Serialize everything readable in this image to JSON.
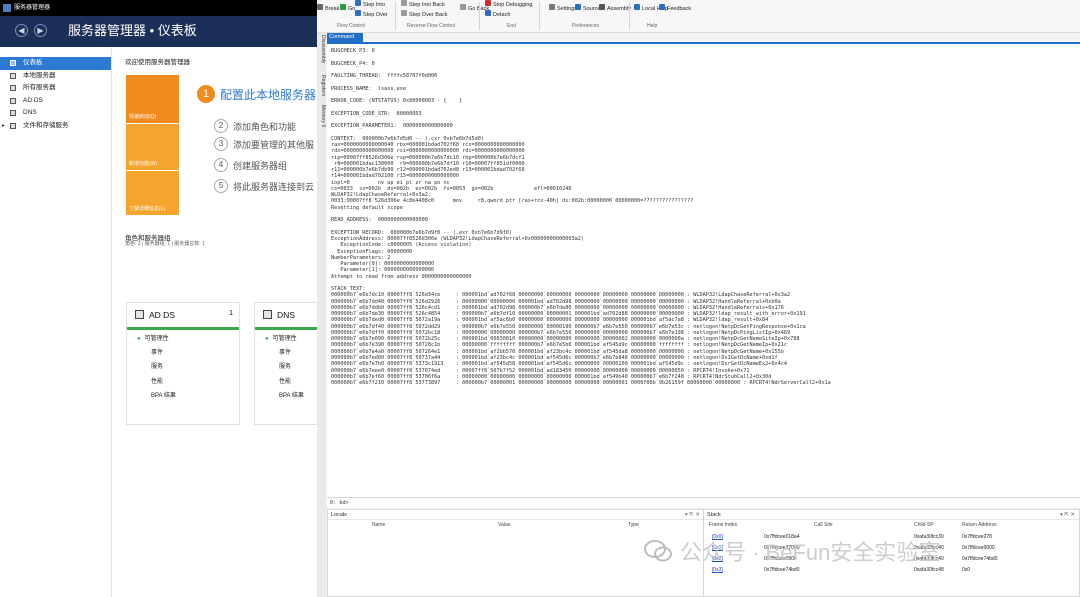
{
  "server_manager": {
    "window_title": "服务器管理器",
    "header_title": "服务器管理器 • 仪表板",
    "nav_items": [
      {
        "label": "仪表板",
        "selected": true,
        "icon": "dashboard-icon",
        "expander": ""
      },
      {
        "label": "本地服务器",
        "selected": false,
        "icon": "server-icon",
        "expander": ""
      },
      {
        "label": "所有服务器",
        "selected": false,
        "icon": "servers-icon",
        "expander": ""
      },
      {
        "label": "AD DS",
        "selected": false,
        "icon": "ad-ds-icon",
        "expander": ""
      },
      {
        "label": "DNS",
        "selected": false,
        "icon": "dns-icon",
        "expander": ""
      },
      {
        "label": "文件和存储服务",
        "selected": false,
        "icon": "storage-icon",
        "expander": "▸"
      }
    ],
    "welcome_title": "欢迎使用服务器管理器",
    "quick_start": "快速启动(Q)",
    "whats_new": "新增功能(W)",
    "learn_more": "了解详细信息(L)",
    "config_number": "1",
    "config_label": "配置此本地服务器",
    "tasks": [
      {
        "num": "2",
        "label": "添加角色和功能"
      },
      {
        "num": "3",
        "label": "添加要管理的其他服"
      },
      {
        "num": "4",
        "label": "创建服务器组"
      },
      {
        "num": "5",
        "label": "将此服务器连接到云"
      }
    ],
    "roles_title": "角色和服务器组",
    "roles_subtitle": "角色: 3 | 服务器组: 1 | 服务器总数: 1",
    "cards": [
      {
        "name": "AD DS",
        "count": "1",
        "rows": [
          "可管理性",
          "事件",
          "服务",
          "性能",
          "BPA 结果"
        ]
      },
      {
        "name": "DNS",
        "count": "",
        "rows": [
          "可管理性",
          "事件",
          "服务",
          "性能",
          "BPA 结果"
        ]
      }
    ]
  },
  "windbg": {
    "ribbon": [
      {
        "label": "Break",
        "icon": "break-icon"
      },
      {
        "label": "Go",
        "icon": "go-icon"
      },
      {
        "label": "Step Into",
        "icon": "step-into-icon"
      },
      {
        "label": "Step Over",
        "icon": "step-over-icon"
      },
      {
        "label": "Step Into Back",
        "icon": "step-into-back-icon"
      },
      {
        "label": "Step Over Back",
        "icon": "step-over-back-icon"
      },
      {
        "label": "Go Back",
        "icon": "go-back-icon"
      },
      {
        "label": "Stop Debugging",
        "icon": "stop-icon"
      },
      {
        "label": "Detach",
        "icon": "detach-icon"
      },
      {
        "label": "Settings",
        "icon": "settings-icon"
      },
      {
        "label": "Source",
        "icon": "source-icon"
      },
      {
        "label": "Assembly",
        "icon": "assembly-icon"
      },
      {
        "label": "Local Help",
        "icon": "help-icon"
      },
      {
        "label": "Feedback",
        "icon": "feedback-icon"
      }
    ],
    "ribbon_groups": [
      "Flow Control",
      "Reverse Flow Control",
      "End",
      "Preferences",
      "Help"
    ],
    "side_tabs": [
      "Disassembly",
      "Registers",
      "Memory 0"
    ],
    "command_tab": "Command",
    "command_lines": [
      "BUGCHECK_P3: 0",
      "",
      "BUGCHECK_P4: 0",
      "",
      "FAULTING_THREAD:  ffffc58707f0d000",
      "",
      "PROCESS_NAME:  lsass.exe",
      "",
      "ERROR_CODE: (NTSTATUS) 0x80000003 - {    }",
      "",
      "EXCEPTION_CODE_STR:  80000003",
      "",
      "EXCEPTION_PARAMETER1:  0000000000000000",
      "",
      "CONTEXT:  000000b7e6b7d5d0 -- (.cxr 0xb7e6b7d5d0)",
      "rax=0000000000000040 rbx=000001bdad702f68 rcx=0000000000000000",
      "rdx=0000000000000000 rsi=0000000000000000 rdi=0000000000000000",
      "rip=00007ff8526d306e rsp=000000b7e6b7dc10 rbp=000000b7e6b7dcf1",
      " r8=000001bdac130000  r9=000000b7e6b7df10 r10=00007ff851df0000",
      "r11=000000b7e6b7db90 r12=000001bdad702ed8 r13=000001bdad702f68",
      "r14=000001bdad702100 r15=0000000000000000",
      "iopl=0         nv up ei pl zr na po nc",
      "cs=0033  ss=002b  ds=002b  es=002b  fs=0053  gs=002b             efl=00010246",
      "WLDAP32!LdapChaseReferral+0x3a2:",
      "0033:00007ff8`526d306e 4c8b4408c0      mov     r8,qword ptr [rax+rcx-40h] ds:002b:00000000`00000000=????????????????",
      "Resetting default scope",
      "",
      "READ_ADDRESS:  0000000000000000",
      "",
      "EXCEPTION_RECORD:  000000b7e6b7d9f0 -- (.exr 0xb7e6b7d9f0)",
      "ExceptionAddress: 00007ff8526d306e (WLDAP32!LdapChaseReferral+0x00000000000003a2)",
      "   ExceptionCode: c0000005 (Access violation)",
      "  ExceptionFlags: 00000000",
      "NumberParameters: 2",
      "   Parameter[0]: 0000000000000000",
      "   Parameter[1]: 0000000000000000",
      "Attempt to read from address 0000000000000000",
      "",
      "STACK_TEXT:",
      "000000b7`e6b7dc10 00007ff8`526d34ce     : 000001bd`ad702f68 00000000`00000000 00000000`00000000 00000000`00000000 : WLDAP32!LdapChaseReferral+0x3a2",
      "000000b7`e6b7dd40 00007ff8`526d2926     : 00000000`00000000 000001bd`ad702d98 00000000`00000000 00000000`00000000 : WLDAP32!HandleReferral+0xb0a",
      "000000b7`e6b7ddb0 00007ff8`526c4cd1     : 000001bd`ad702d98 000000b7`e6b7de80 00000000`00000000 00000000`00000000 : WLDAP32!HandleReferrals+0x176",
      "000000b7`e6b7de30 00007ff8`526c4854     : 000000b7`e6b7df10 00000000`00000001 000001bd`ad702d88 00000000`00000000 : WLDAP32!ldap_result_with_error+0x191",
      "000000b7`e6b7ded0 00007ff8`5072a19a     : 000001bd`af5ac6b0 00000000`00000000 00000000`00000000 000001bd`af5ac7a8 : WLDAP32!ldap_result+0x84",
      "000000b7`e6b7df40 00007ff8`5072dd29     : 000000b7`e6b7e550 00000000`00000190 000000b7`e6b7e550 000000b7`e6b7e53c : netlogon!NetpDcGetPingResponse+0x1ca",
      "000000b7`e6b7dff0 00007ff8`5072bc18     : 00000000`00000000 000000b7`e6b7e550 00000000`00000000 000000b7`e6b7e198 : netlogon!NetpDcPingListIp+0x469",
      "000000b7`e6b7e090 00007ff8`5072b25c     : 000001bd`00030010 00000000`00000000 00000000`00000002 00000000`0000000a : netlogon!NetpDcGetNameSiteIp+0x788",
      "000000b7`e6b7e390 00007ff8`50728c1b     : 00000000`ffffffff 000000b7`e6b7e5b0 000001bd`af545d9c 00000000`ffffffff : netlogon!NetpDcGetNameIp+0x21c",
      "000000b7`e6b7e4a0 00007ff8`507264e1     : 000001bd`af2bb570 000001bd`af23bc4c 000001bd`af545da8 00000000`00000000 : netlogon!NetpDcGetName+0x155b",
      "000000b7`e6b7ed00 00007ff8`50737a44     : 000001bd`af23bc4c 000001bd`af545d6c 000000b7`e6b7e848 00000000`00000000 : netlogon!DsIGetDcName+0xd1f",
      "000000b7`e6b7e7b0 00007ff8`5373c1913    : 000001bd`af545d58 000001bd`af545d6c 00000000`00000200 000001bd`af545d9c : netlogon!DsrGetDcNameEx2+0x4c4",
      "000000b7`e6b7eee0 00007ff8`537074ed     : 00007ff8`507b7f52 000001bd`ad183450 00000000`00000000 00000000`00000050 : RPCRT4!Invoke+0x71",
      "000000b7`e6b7ef60 00007ff8`53706f6a     : 00000000`00000000 00000000`00000000 000001bd`af549b40 000000b7`e6b7f248 : RPCRT4!NdrStubCall2+0x30d",
      "000000b7`e6b7f210 00007ff8`53773897     : 000000b7`00000001 00000000`00000000 00000000`00000001 0000f00b`9b26159f 00000000`00000000 : RPCRT4!NdrServerCall2+0x1a"
    ],
    "command_input": "0: kd>",
    "locals_title": "Locals",
    "locals_headers": [
      "Name",
      "Value",
      "Type"
    ],
    "stack_title": "Stack",
    "stack_headers": [
      "Frame Index",
      "Call Site",
      "Child-SP",
      "Return Address"
    ],
    "stack_rows": [
      {
        "frame": "[0x0]",
        "call_site": "0x7ffdcee018a4",
        "child_sp": "0xafa30fcc30",
        "ret": "0x7ffdcee278"
      },
      {
        "frame": "[0x1]",
        "call_site": "0x7ffdcee27000",
        "child_sp": "0xafa30fcc40",
        "ret": "0x7ffdcee0000"
      },
      {
        "frame": "[0x2]",
        "call_site": "0x7ffdcee0000",
        "child_sp": "0xafa30fcc40",
        "ret": "0x7ffdcee74bd0"
      },
      {
        "frame": "[0x3]",
        "call_site": "0x7ffdcee74bd0",
        "child_sp": "0xafa30fcc48",
        "ret": "0x0"
      }
    ]
  },
  "watermark": "公众号 · BeFun安全实验室"
}
